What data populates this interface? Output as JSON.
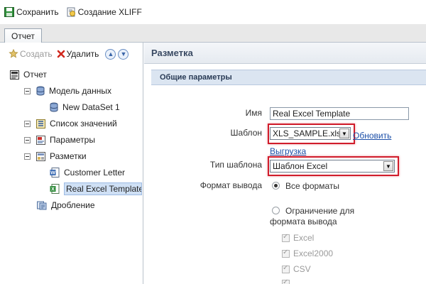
{
  "toolbar": {
    "save_label": "Сохранить",
    "xliff_label": "Создание XLIFF"
  },
  "tabs": [
    {
      "label": "Отчет",
      "active": true
    }
  ],
  "left_panel": {
    "create_label": "Создать",
    "delete_label": "Удалить",
    "tree": {
      "root": "Отчет",
      "data_model": "Модель данных",
      "dataset": "New DataSet 1",
      "lov": "Список значений",
      "parameters": "Параметры",
      "layouts": "Разметки",
      "customer_letter": "Customer Letter",
      "real_excel": "Real Excel Template",
      "bursting": "Дробление"
    }
  },
  "right_panel": {
    "header": "Разметка",
    "section": "Общие параметры",
    "name_label": "Имя",
    "name_value": "Real Excel Template",
    "template_label": "Шаблон",
    "template_value": "XLS_SAMPLE.xls",
    "refresh_link": "Обновить",
    "download_link": "Выгрузка",
    "template_type_label": "Тип шаблона",
    "template_type_value": "Шаблон Excel",
    "output_format_label": "Формат вывода",
    "all_formats": "Все форматы",
    "restrict_line1": "Ограничение для",
    "restrict_line2": "формата вывода",
    "formats": [
      "Excel",
      "Excel2000",
      "CSV"
    ]
  },
  "colors": {
    "highlight": "#d01c2b",
    "link": "#1c4fa8",
    "section_bar": "#dbe5f1",
    "selection": "#cfe0f5"
  }
}
